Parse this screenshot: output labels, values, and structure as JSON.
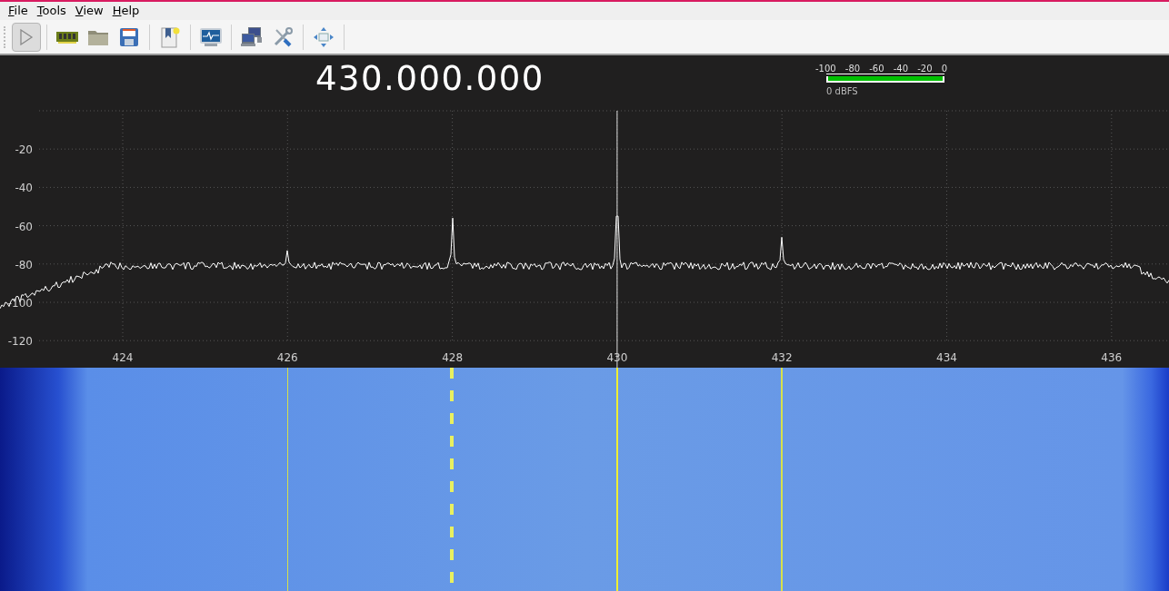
{
  "menu": [
    {
      "label": "File"
    },
    {
      "label": "Tools"
    },
    {
      "label": "View"
    },
    {
      "label": "Help"
    }
  ],
  "start_button": {
    "checked": true
  },
  "frequency_display": "430.000.000",
  "level_meter": {
    "scale": [
      "-100",
      "-80",
      "-60",
      "-40",
      "-20",
      "0"
    ],
    "level": 1,
    "reading": "0 dBFS"
  },
  "spectrum": {
    "y_ticks": [
      "-20",
      "-40",
      "-60",
      "-80",
      "-100",
      "-120"
    ],
    "x_ticks": [
      "424",
      "426",
      "428",
      "430",
      "432",
      "434",
      "436"
    ]
  }
}
